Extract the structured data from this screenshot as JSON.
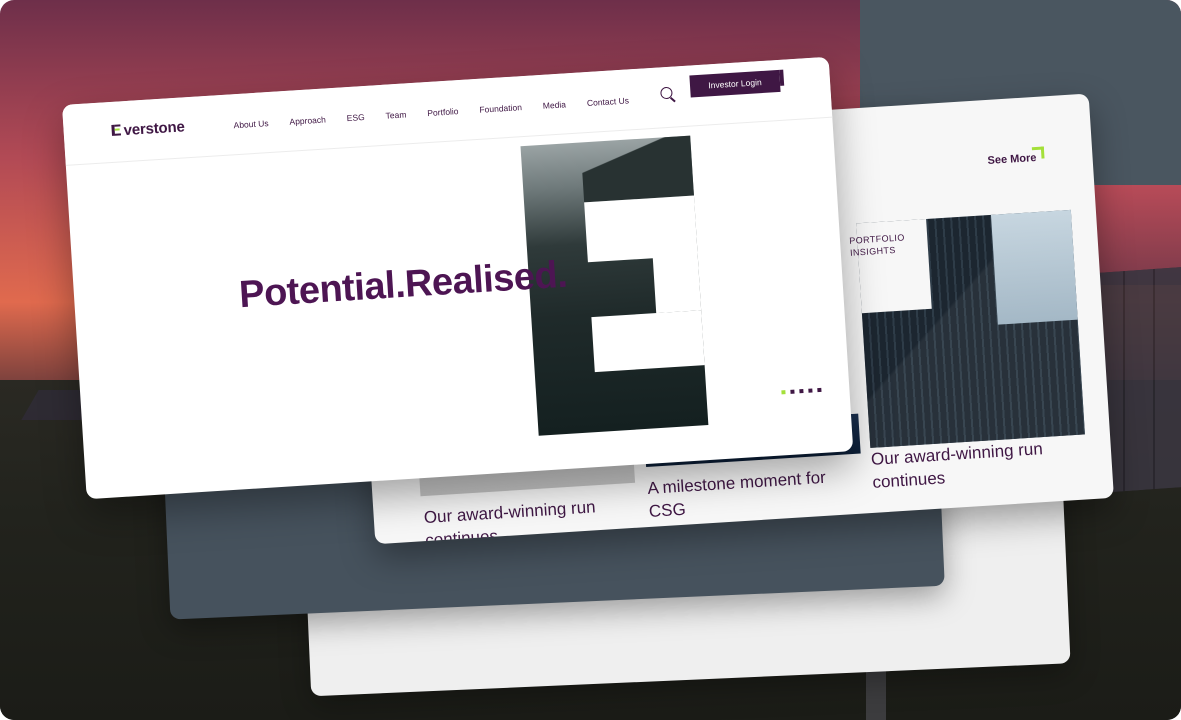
{
  "site": {
    "logo_text": "verstone",
    "nav": {
      "items": [
        "About Us",
        "Approach",
        "ESG",
        "Team",
        "Portfolio",
        "Foundation",
        "Media",
        "Contact Us"
      ],
      "login_label": "Investor Login"
    },
    "hero": {
      "headline": "Potential.Realised.",
      "carousel_dots": 5,
      "active_dot": 1
    }
  },
  "insights": {
    "see_more_label": "See More",
    "section_label": "PORTFOLIO INSIGHTS",
    "articles": [
      {
        "title": "Our award-winning run continues"
      },
      {
        "title": "A milestone moment for CSG"
      },
      {
        "title": "Our award-winning run continues"
      }
    ]
  },
  "colors": {
    "brand": "#3f1744",
    "accent": "#a4e03a"
  }
}
